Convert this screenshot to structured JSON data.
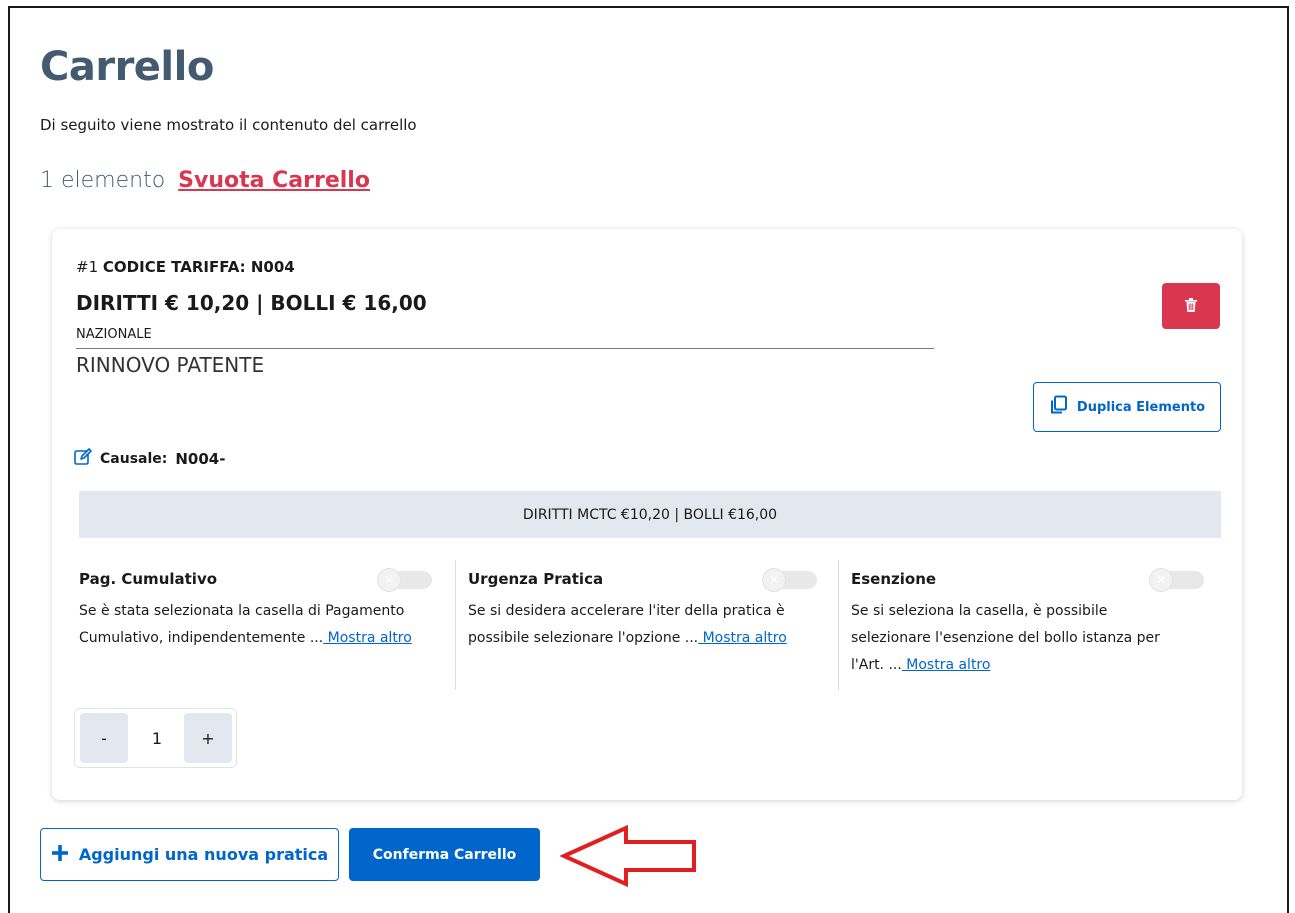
{
  "page": {
    "title": "Carrello",
    "subtitle": "Di seguito viene mostrato il contenuto del carrello",
    "item_count": "1 elemento",
    "empty_cart_link": "Svuota Carrello"
  },
  "item": {
    "index": "#1",
    "code_label": "CODICE TARIFFA: N004",
    "fees": "DIRITTI € 10,20 | BOLLI € 16,00",
    "scope": "NAZIONALE",
    "service": "RINNOVO PATENTE",
    "duplicate_label": "Duplica Elemento",
    "causale_label": "Causale:",
    "causale_value": "N004-",
    "banner": "DIRITTI MCTC €10,20 | BOLLI €16,00",
    "quantity": "1",
    "minus_label": "-",
    "plus_label": "+"
  },
  "options": [
    {
      "title": "Pag. Cumulativo",
      "desc_line1": "Se è stata selezionata la casella di Pagamento",
      "desc_line2": "Cumulativo, indipendentemente ...",
      "more": " Mostra altro"
    },
    {
      "title": "Urgenza Pratica",
      "desc_line1": "Se si desidera accelerare l'iter della pratica è",
      "desc_line2": "possibile selezionare l'opzione ...",
      "more": " Mostra altro"
    },
    {
      "title": "Esenzione",
      "desc_line1": "Se si seleziona la casella, è possibile",
      "desc_line2": "selezionare l'esenzione del bollo istanza per",
      "desc_line3": "l'Art. ...",
      "more": " Mostra altro"
    }
  ],
  "actions": {
    "add_label": "Aggiungi una nuova pratica",
    "confirm_label": "Conferma Carrello"
  },
  "colors": {
    "primary": "#0066cc",
    "danger": "#d9364f",
    "heading": "#435a70",
    "banner_bg": "#e3e7ef",
    "annotation_arrow": "#e02020"
  },
  "icons": [
    "trash-icon",
    "copy-icon",
    "edit-icon",
    "plus-icon",
    "toggle-x-icon",
    "red-arrow-annotation"
  ]
}
